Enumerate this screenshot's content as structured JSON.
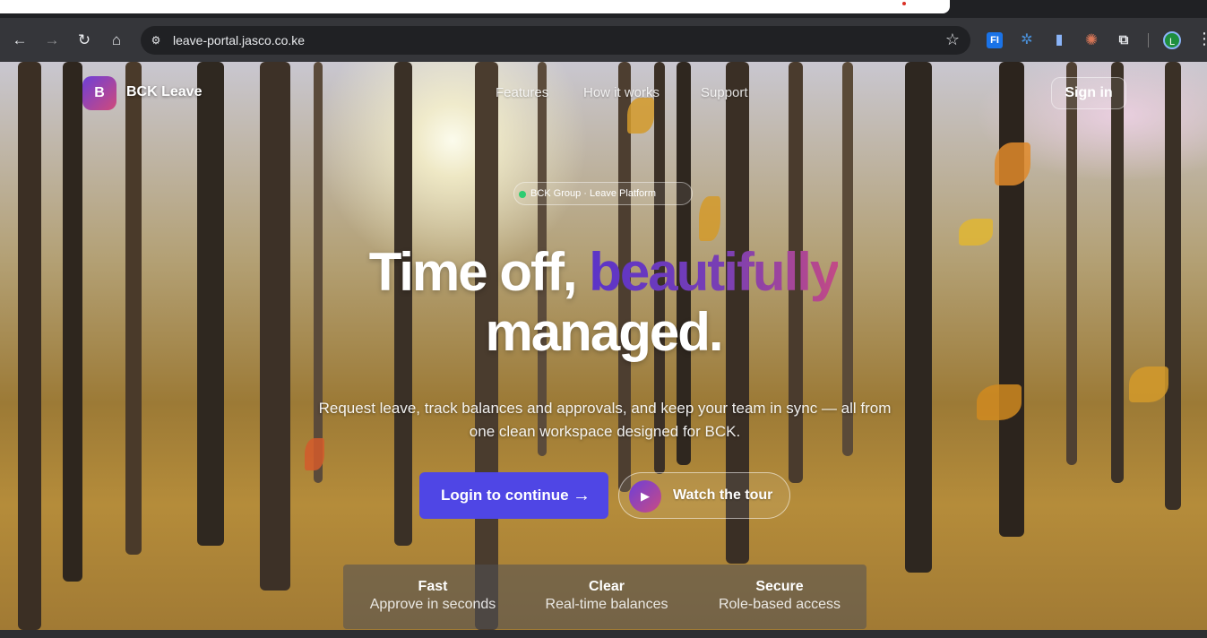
{
  "browser": {
    "url": "leave-portal.jasco.co.ke",
    "profile_initial": "L",
    "extensions": [
      {
        "name": "fi-extension-icon",
        "label": "FI",
        "color": "#1a73e8"
      },
      {
        "name": "puzzle-blue-extension-icon",
        "label": "✲",
        "color": "#4a90d9"
      },
      {
        "name": "docs-extension-icon",
        "label": "▮",
        "color": "#4285f4"
      },
      {
        "name": "claude-extension-icon",
        "label": "✺",
        "color": "#d97757"
      }
    ]
  },
  "site": {
    "logo_letter": "B",
    "brand": "BCK Leave",
    "nav": {
      "features": "Features",
      "how": "How it works",
      "support": "Support"
    },
    "signin": "Sign in",
    "pill": "BCK Group · Leave Platform",
    "headline_part1": "Time off, ",
    "headline_accent": "beautifully",
    "headline_line2": "managed.",
    "subtitle": "Request leave, track balances and approvals, and keep your team in sync — all from one clean workspace designed for BCK.",
    "primary_cta": "Login to continue",
    "secondary_cta": "Watch the tour",
    "stats": [
      {
        "title": "Fast",
        "desc": "Approve in seconds"
      },
      {
        "title": "Clear",
        "desc": "Real-time balances"
      },
      {
        "title": "Secure",
        "desc": "Role-based access"
      }
    ]
  }
}
